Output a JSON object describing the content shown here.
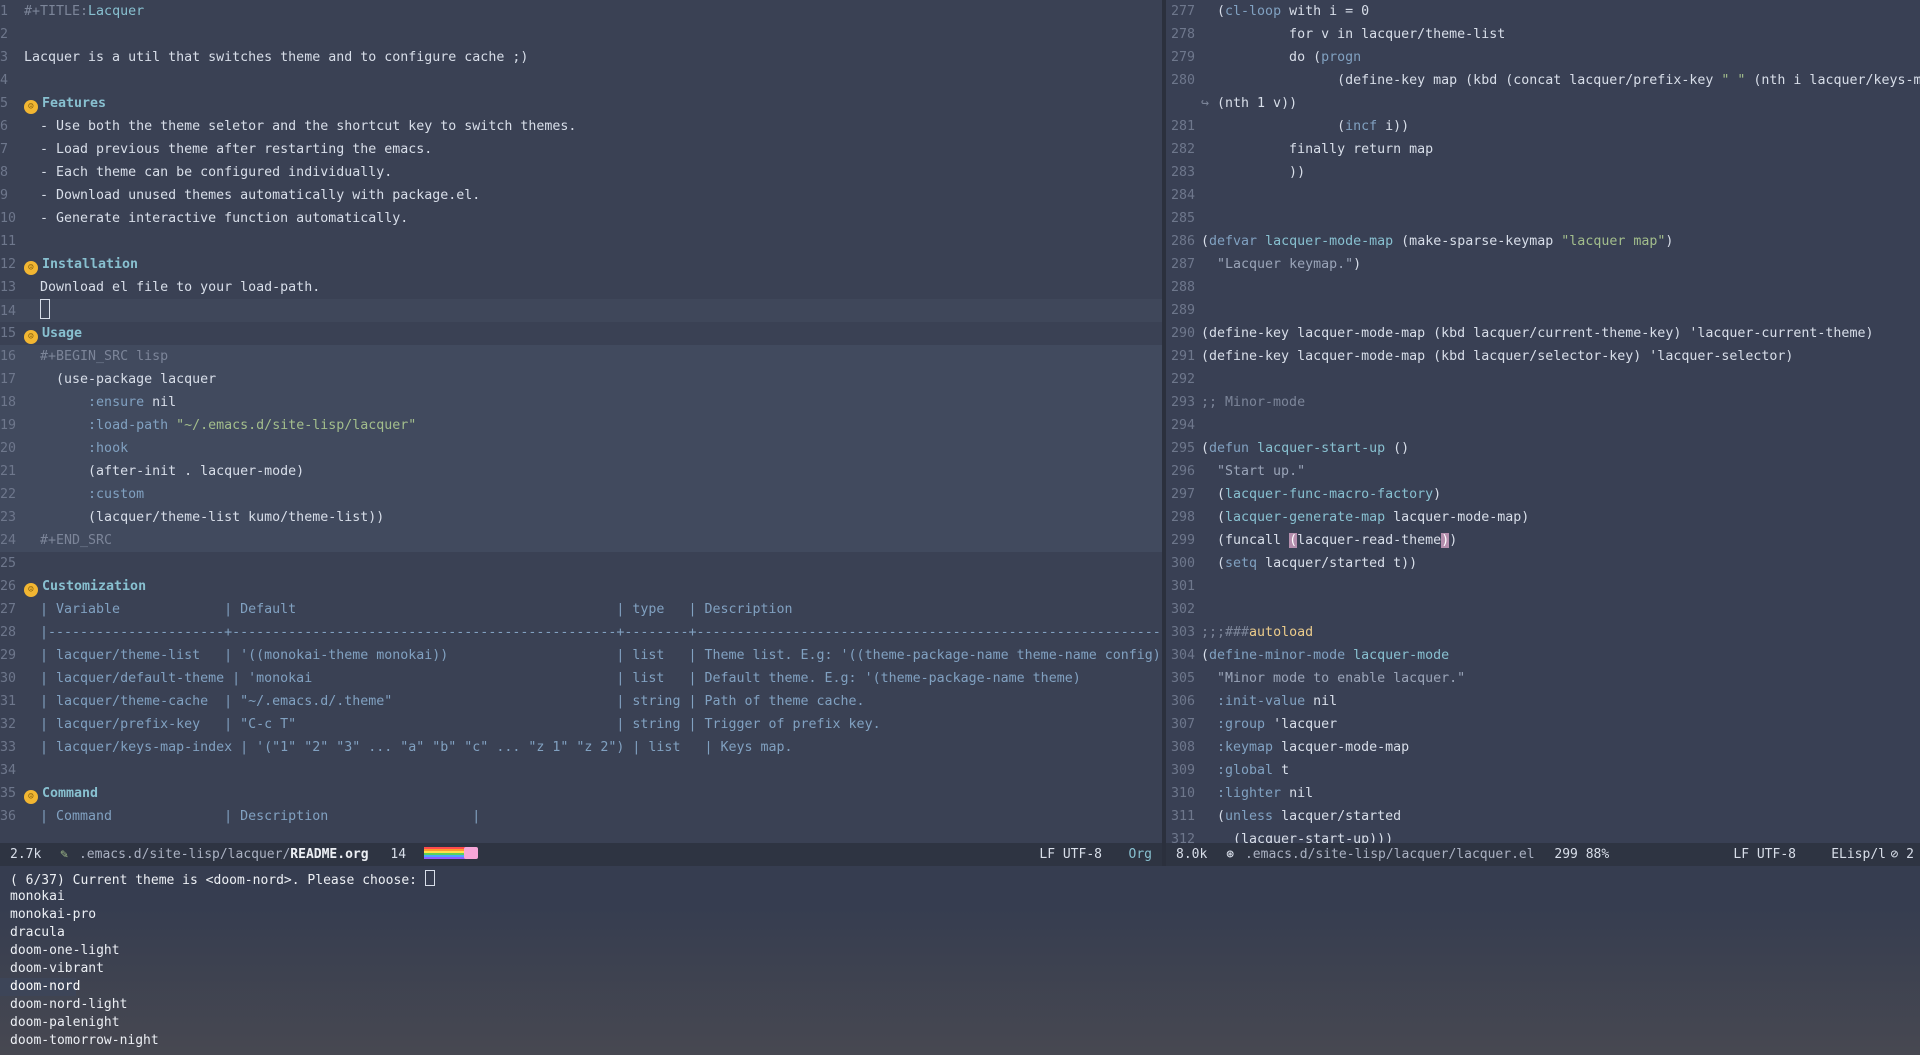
{
  "left_lines": [
    {
      "n": "1",
      "cls": "",
      "html": "<span class='dim'>#+TITLE:</span><span class='fn'>Lacquer</span>"
    },
    {
      "n": "2",
      "cls": "",
      "html": ""
    },
    {
      "n": "3",
      "cls": "",
      "html": "Lacquer is a util that switches theme and to configure cache ;)"
    },
    {
      "n": "4",
      "cls": "",
      "html": ""
    },
    {
      "n": "5",
      "cls": "",
      "html": "<span class='emoji'>☺</span><span class='head'>Features</span>"
    },
    {
      "n": "6",
      "cls": "",
      "html": "  - Use both the theme seletor and the shortcut key to switch themes."
    },
    {
      "n": "7",
      "cls": "",
      "html": "  - Load previous theme after restarting the emacs."
    },
    {
      "n": "8",
      "cls": "",
      "html": "  - Each theme can be configured individually."
    },
    {
      "n": "9",
      "cls": "",
      "html": "  - Download unused themes automatically with package.el."
    },
    {
      "n": "10",
      "cls": "",
      "html": "  - Generate interactive function automatically."
    },
    {
      "n": "11",
      "cls": "",
      "html": ""
    },
    {
      "n": "12",
      "cls": "",
      "html": "<span class='emoji'>☺</span><span class='head'>Installation</span>"
    },
    {
      "n": "13",
      "cls": "",
      "html": "  Download el file to your load-path."
    },
    {
      "n": "14",
      "cls": "curline",
      "html": "  <span class='cursor'></span>"
    },
    {
      "n": "15",
      "cls": "",
      "html": "<span class='emoji'>☺</span><span class='head'>Usage</span>"
    },
    {
      "n": "16",
      "cls": "src",
      "html": "  <span class='dim'>#+BEGIN_SRC lisp</span>"
    },
    {
      "n": "17",
      "cls": "src",
      "html": "    (use-package lacquer"
    },
    {
      "n": "18",
      "cls": "src",
      "html": "        <span class='kw'>:ensure</span> nil"
    },
    {
      "n": "19",
      "cls": "src",
      "html": "        <span class='kw'>:load-path</span> <span class='str'>\"~/.emacs.d/site-lisp/lacquer\"</span>"
    },
    {
      "n": "20",
      "cls": "src",
      "html": "        <span class='kw'>:hook</span>"
    },
    {
      "n": "21",
      "cls": "src",
      "html": "        (after-init . lacquer-mode)"
    },
    {
      "n": "22",
      "cls": "src",
      "html": "        <span class='kw'>:custom</span>"
    },
    {
      "n": "23",
      "cls": "src",
      "html": "        (lacquer/theme-list kumo/theme-list))"
    },
    {
      "n": "24",
      "cls": "src",
      "html": "  <span class='dim'>#+END_SRC</span>"
    },
    {
      "n": "25",
      "cls": "",
      "html": ""
    },
    {
      "n": "26",
      "cls": "",
      "html": "<span class='emoji'>☺</span><span class='head'>Customization</span>"
    },
    {
      "n": "27",
      "cls": "",
      "html": "<span class='tbl'>  | Variable             | Default                                        | type   | Description                                                   |</span>"
    },
    {
      "n": "28",
      "cls": "",
      "html": "<span class='tbl'>  |----------------------+------------------------------------------------+--------+---------------------------------------------------------------|</span>"
    },
    {
      "n": "29",
      "cls": "",
      "html": "<span class='tbl'>  | lacquer/theme-list   | '((monokai-theme monokai))                     | list   | Theme list. E.g: '((theme-package-name theme-name config)). |</span>"
    },
    {
      "n": "30",
      "cls": "",
      "html": "<span class='tbl'>  | lacquer/default-theme | 'monokai                                      | list   | Default theme. E.g: '(theme-package-name theme)              |</span>"
    },
    {
      "n": "31",
      "cls": "",
      "html": "<span class='tbl'>  | lacquer/theme-cache  | \"~/.emacs.d/.theme\"                            | string | Path of theme cache.                                          |</span>"
    },
    {
      "n": "32",
      "cls": "",
      "html": "<span class='tbl'>  | lacquer/prefix-key   | \"C-c T\"                                        | string | Trigger of prefix key.                                        |</span>"
    },
    {
      "n": "33",
      "cls": "",
      "html": "<span class='tbl'>  | lacquer/keys-map-index | '(\"1\" \"2\" \"3\" ... \"a\" \"b\" \"c\" ... \"z 1\" \"z 2\") | list   | Keys map.                                                     |</span>"
    },
    {
      "n": "34",
      "cls": "",
      "html": ""
    },
    {
      "n": "35",
      "cls": "",
      "html": "<span class='emoji'>☺</span><span class='head'>Command</span>"
    },
    {
      "n": "36",
      "cls": "",
      "html": "<span class='tbl'>  | Command              | Description                  |</span>"
    }
  ],
  "right_lines": [
    {
      "n": "277",
      "html": "  (<span class='kw'>cl-loop</span> with i = 0"
    },
    {
      "n": "278",
      "html": "           for v in lacquer/theme-list"
    },
    {
      "n": "279",
      "html": "           do (<span class='kw'>progn</span>"
    },
    {
      "n": "280",
      "html": "                 (define-key map (kbd (concat lacquer/prefix-key <span class='str'>\" \"</span> (nth i lacquer/keys-map-index)))"
    },
    {
      "n": "",
      "html": "<span class='dim'>↪</span> (nth 1 v))"
    },
    {
      "n": "281",
      "html": "                 (<span class='kw'>incf</span> i))"
    },
    {
      "n": "282",
      "html": "           finally return map"
    },
    {
      "n": "283",
      "html": "           ))"
    },
    {
      "n": "284",
      "html": ""
    },
    {
      "n": "285",
      "html": ""
    },
    {
      "n": "286",
      "html": "(<span class='kw'>defvar</span> <span class='fn'>lacquer-mode-map</span> (make-sparse-keymap <span class='str'>\"lacquer map\"</span>)"
    },
    {
      "n": "287",
      "html": "  <span class='doc'>\"Lacquer keymap.\"</span>)"
    },
    {
      "n": "288",
      "html": ""
    },
    {
      "n": "289",
      "html": ""
    },
    {
      "n": "290",
      "html": "(define-key lacquer-mode-map (kbd lacquer/current-theme-key) 'lacquer-current-theme)"
    },
    {
      "n": "291",
      "html": "(define-key lacquer-mode-map (kbd lacquer/selector-key) 'lacquer-selector)"
    },
    {
      "n": "292",
      "html": ""
    },
    {
      "n": "293",
      "html": "<span class='dim'>;; Minor-mode</span>"
    },
    {
      "n": "294",
      "html": ""
    },
    {
      "n": "295",
      "html": "(<span class='kw'>defun</span> <span class='fn'>lacquer-start-up</span> ()"
    },
    {
      "n": "296",
      "html": "  <span class='doc'>\"Start up.\"</span>"
    },
    {
      "n": "297",
      "html": "  (<span class='fn'>lacquer-func-macro-factory</span>)"
    },
    {
      "n": "298",
      "html": "  (<span class='fn'>lacquer-generate-map</span> lacquer-mode-map)"
    },
    {
      "n": "299",
      "html": "  (funcall <span style='background:#b48ead;color:#fff'>(</span>lacquer-read-theme<span style='background:#b48ead;color:#fff'>)</span>)"
    },
    {
      "n": "300",
      "html": "  (<span class='kw'>setq</span> lacquer/started t))"
    },
    {
      "n": "301",
      "html": ""
    },
    {
      "n": "302",
      "html": ""
    },
    {
      "n": "303",
      "html": "<span class='dim'>;;;###</span><span style='color:#ebcb8b'>autoload</span>"
    },
    {
      "n": "304",
      "html": "(<span class='kw'>define-minor-mode</span> <span class='fn'>lacquer-mode</span>"
    },
    {
      "n": "305",
      "html": "  <span class='doc'>\"Minor mode to enable lacquer.\"</span>"
    },
    {
      "n": "306",
      "html": "  <span class='kw'>:init-value</span> nil"
    },
    {
      "n": "307",
      "html": "  <span class='kw'>:group</span> 'lacquer"
    },
    {
      "n": "308",
      "html": "  <span class='kw'>:keymap</span> lacquer-mode-map"
    },
    {
      "n": "309",
      "html": "  <span class='kw'>:global</span> t"
    },
    {
      "n": "310",
      "html": "  <span class='kw'>:lighter</span> nil"
    },
    {
      "n": "311",
      "html": "  (<span class='kw'>unless</span> lacquer/started"
    },
    {
      "n": "312",
      "html": "    (lacquer-start-up)))"
    }
  ],
  "modeline_left": {
    "size": "2.7k",
    "path_dim": ".emacs.d/site-lisp/lacquer/",
    "file": "README.org",
    "col": "14",
    "encoding": "LF UTF-8",
    "mode": "Org"
  },
  "modeline_right": {
    "size": "8.0k",
    "path": ".emacs.d/site-lisp/lacquer/lacquer.el",
    "pos": "299 88%",
    "encoding": "LF UTF-8",
    "mode": "ELisp/l",
    "extra": "2"
  },
  "minibuffer": {
    "prompt": "( 6/37) Current theme is <doom-nord>. Please choose: ",
    "items": [
      "monokai",
      "monokai-pro",
      "dracula",
      "doom-one-light",
      "doom-vibrant",
      "doom-nord",
      "doom-nord-light",
      "doom-palenight",
      "doom-tomorrow-night"
    ],
    "selected": "doom-nord"
  }
}
